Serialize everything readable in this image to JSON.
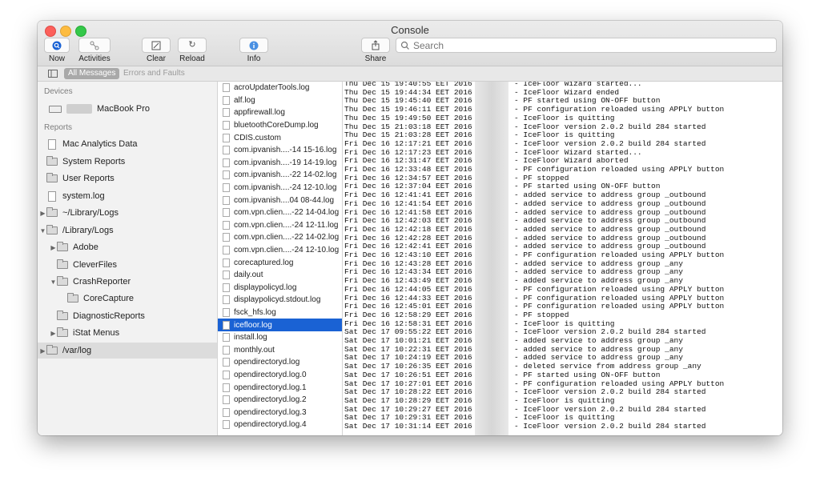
{
  "window": {
    "title": "Console"
  },
  "toolbar": {
    "now": "Now",
    "activities": "Activities",
    "clear": "Clear",
    "reload": "Reload",
    "info": "Info",
    "share": "Share",
    "search_placeholder": "Search"
  },
  "filter": {
    "all_messages": "All Messages",
    "errors_and_faults": "Errors and Faults"
  },
  "sidebar": {
    "devices_header": "Devices",
    "device": "MacBook Pro",
    "reports_header": "Reports",
    "items": [
      {
        "label": "Mac Analytics Data",
        "icon": "doc",
        "indent": 0,
        "tri": ""
      },
      {
        "label": "System Reports",
        "icon": "folder",
        "indent": 0,
        "tri": ""
      },
      {
        "label": "User Reports",
        "icon": "folder",
        "indent": 0,
        "tri": ""
      },
      {
        "label": "system.log",
        "icon": "doc",
        "indent": 0,
        "tri": ""
      },
      {
        "label": "~/Library/Logs",
        "icon": "folder",
        "indent": 0,
        "tri": "▶"
      },
      {
        "label": "/Library/Logs",
        "icon": "folder",
        "indent": 0,
        "tri": "▼"
      },
      {
        "label": "Adobe",
        "icon": "folder",
        "indent": 1,
        "tri": "▶"
      },
      {
        "label": "CleverFiles",
        "icon": "folder",
        "indent": 1,
        "tri": ""
      },
      {
        "label": "CrashReporter",
        "icon": "folder",
        "indent": 1,
        "tri": "▼"
      },
      {
        "label": "CoreCapture",
        "icon": "folder",
        "indent": 2,
        "tri": ""
      },
      {
        "label": "DiagnosticReports",
        "icon": "folder",
        "indent": 1,
        "tri": ""
      },
      {
        "label": "iStat Menus",
        "icon": "folder",
        "indent": 1,
        "tri": "▶"
      },
      {
        "label": "/var/log",
        "icon": "folder",
        "indent": 0,
        "tri": "▶",
        "selected": true
      }
    ]
  },
  "files": [
    "acroUpdaterTools.log",
    "alf.log",
    "appfirewall.log",
    "bluetoothCoreDump.log",
    "CDIS.custom",
    "com.ipvanish....-14 15-16.log",
    "com.ipvanish....-19 14-19.log",
    "com.ipvanish....-22 14-02.log",
    "com.ipvanish....-24 12-10.log",
    "com.ipvanish....04 08-44.log",
    "com.vpn.clien....-22 14-04.log",
    "com.vpn.clien....-24 12-11.log",
    "com.vpn.clien....-22 14-02.log",
    "com.vpn.clien....-24 12-10.log",
    "corecaptured.log",
    "daily.out",
    "displaypolicyd.log",
    "displaypolicyd.stdout.log",
    "fsck_hfs.log",
    "icefloor.log",
    "install.log",
    "monthly.out",
    "opendirectoryd.log",
    "opendirectoryd.log.0",
    "opendirectoryd.log.1",
    "opendirectoryd.log.2",
    "opendirectoryd.log.3",
    "opendirectoryd.log.4"
  ],
  "selected_file": "icefloor.log",
  "log": [
    {
      "ts": "Thu Dec 15 19:40:55 EET 2016",
      "msg": "- IceFloor Wizard started..."
    },
    {
      "ts": "Thu Dec 15 19:44:34 EET 2016",
      "msg": "- IceFloor Wizard ended"
    },
    {
      "ts": "Thu Dec 15 19:45:40 EET 2016",
      "msg": "- PF started using ON-OFF button"
    },
    {
      "ts": "Thu Dec 15 19:46:11 EET 2016",
      "msg": "- PF configuration reloaded using APPLY button"
    },
    {
      "ts": "Thu Dec 15 19:49:50 EET 2016",
      "msg": "- IceFloor is quitting"
    },
    {
      "ts": "Thu Dec 15 21:03:18 EET 2016",
      "msg": "- IceFloor version 2.0.2 build 284 started"
    },
    {
      "ts": "Thu Dec 15 21:03:28 EET 2016",
      "msg": "- IceFloor is quitting"
    },
    {
      "ts": "Fri Dec 16 12:17:21 EET 2016",
      "msg": "- IceFloor version 2.0.2 build 284 started"
    },
    {
      "ts": "Fri Dec 16 12:17:23 EET 2016",
      "msg": "- IceFloor Wizard started..."
    },
    {
      "ts": "Fri Dec 16 12:31:47 EET 2016",
      "msg": "- IceFloor Wizard aborted"
    },
    {
      "ts": "Fri Dec 16 12:33:48 EET 2016",
      "msg": "- PF configuration reloaded using APPLY button"
    },
    {
      "ts": "Fri Dec 16 12:34:57 EET 2016",
      "msg": "- PF stopped"
    },
    {
      "ts": "Fri Dec 16 12:37:04 EET 2016",
      "msg": "- PF started using ON-OFF button"
    },
    {
      "ts": "Fri Dec 16 12:41:41 EET 2016",
      "msg": "- added service to address group _outbound"
    },
    {
      "ts": "Fri Dec 16 12:41:54 EET 2016",
      "msg": "- added service to address group _outbound"
    },
    {
      "ts": "Fri Dec 16 12:41:58 EET 2016",
      "msg": "- added service to address group _outbound"
    },
    {
      "ts": "Fri Dec 16 12:42:03 EET 2016",
      "msg": "- added service to address group _outbound"
    },
    {
      "ts": "Fri Dec 16 12:42:18 EET 2016",
      "msg": "- added service to address group _outbound"
    },
    {
      "ts": "Fri Dec 16 12:42:28 EET 2016",
      "msg": "- added service to address group _outbound"
    },
    {
      "ts": "Fri Dec 16 12:42:41 EET 2016",
      "msg": "- added service to address group _outbound"
    },
    {
      "ts": "Fri Dec 16 12:43:10 EET 2016",
      "msg": "- PF configuration reloaded using APPLY button"
    },
    {
      "ts": "Fri Dec 16 12:43:28 EET 2016",
      "msg": "- added service to address group _any"
    },
    {
      "ts": "Fri Dec 16 12:43:34 EET 2016",
      "msg": "- added service to address group _any"
    },
    {
      "ts": "Fri Dec 16 12:43:49 EET 2016",
      "msg": "- added service to address group _any"
    },
    {
      "ts": "Fri Dec 16 12:44:05 EET 2016",
      "msg": "- PF configuration reloaded using APPLY button"
    },
    {
      "ts": "Fri Dec 16 12:44:33 EET 2016",
      "msg": "- PF configuration reloaded using APPLY button"
    },
    {
      "ts": "Fri Dec 16 12:45:01 EET 2016",
      "msg": "- PF configuration reloaded using APPLY button"
    },
    {
      "ts": "Fri Dec 16 12:58:29 EET 2016",
      "msg": "- PF stopped"
    },
    {
      "ts": "Fri Dec 16 12:58:31 EET 2016",
      "msg": "- IceFloor is quitting"
    },
    {
      "ts": "Sat Dec 17 09:55:22 EET 2016",
      "msg": "- IceFloor version 2.0.2 build 284 started"
    },
    {
      "ts": "Sat Dec 17 10:01:21 EET 2016",
      "msg": "- added service to address group _any"
    },
    {
      "ts": "Sat Dec 17 10:22:31 EET 2016",
      "msg": "- added service to address group _any"
    },
    {
      "ts": "Sat Dec 17 10:24:19 EET 2016",
      "msg": "- added service to address group _any"
    },
    {
      "ts": "Sat Dec 17 10:26:35 EET 2016",
      "msg": "- deleted service from address group _any"
    },
    {
      "ts": "Sat Dec 17 10:26:51 EET 2016",
      "msg": "- PF started using ON-OFF button"
    },
    {
      "ts": "Sat Dec 17 10:27:01 EET 2016",
      "msg": "- PF configuration reloaded using APPLY button"
    },
    {
      "ts": "Sat Dec 17 10:28:22 EET 2016",
      "msg": "- IceFloor version 2.0.2 build 284 started"
    },
    {
      "ts": "Sat Dec 17 10:28:29 EET 2016",
      "msg": "- IceFloor is quitting"
    },
    {
      "ts": "Sat Dec 17 10:29:27 EET 2016",
      "msg": "- IceFloor version 2.0.2 build 284 started"
    },
    {
      "ts": "Sat Dec 17 10:29:31 EET 2016",
      "msg": "- IceFloor is quitting"
    },
    {
      "ts": "Sat Dec 17 10:31:14 EET 2016",
      "msg": "- IceFloor version 2.0.2 build 284 started"
    }
  ],
  "colors": {
    "selection": "#1a62d4",
    "info_icon": "#4a90e2",
    "now_icon": "#1a62d4"
  }
}
